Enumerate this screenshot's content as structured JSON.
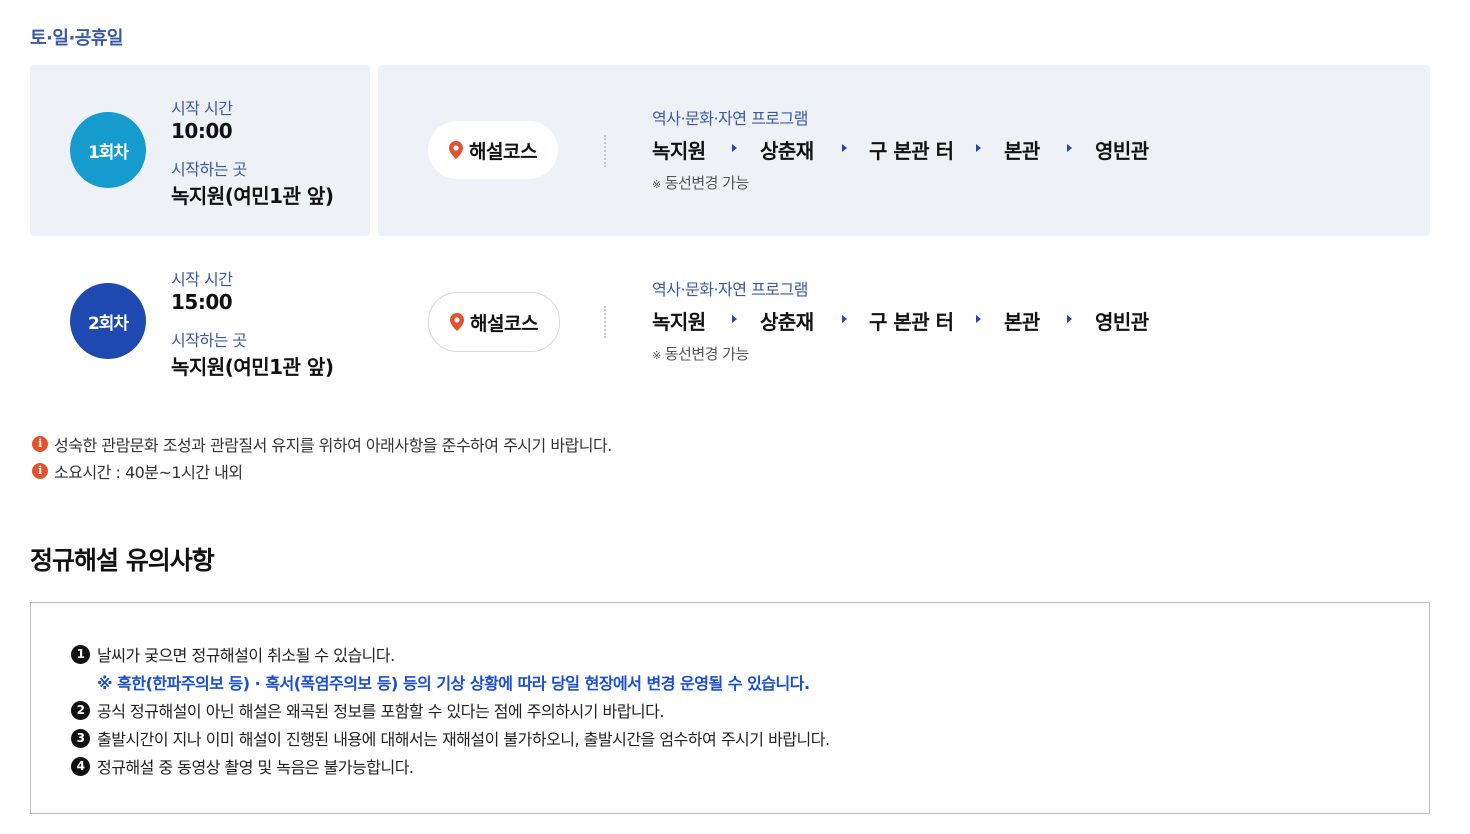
{
  "day_title": "토·일·공휴일",
  "sessions": [
    {
      "badge": "1회차",
      "start_time_label": "시작 시간",
      "start_time": "10:00",
      "start_place_label": "시작하는 곳",
      "start_place": "녹지원(여민1관 앞)",
      "course_label": "해설코스",
      "program": "역사·문화·자연 프로그램",
      "stops": [
        "녹지원",
        "상춘재",
        "구 본관 터",
        "본관",
        "영빈관"
      ],
      "note_mark": "※",
      "note": "동선변경 가능"
    },
    {
      "badge": "2회차",
      "start_time_label": "시작 시간",
      "start_time": "15:00",
      "start_place_label": "시작하는 곳",
      "start_place": "녹지원(여민1관 앞)",
      "course_label": "해설코스",
      "program": "역사·문화·자연 프로그램",
      "stops": [
        "녹지원",
        "상춘재",
        "구 본관 터",
        "본관",
        "영빈관"
      ],
      "note_mark": "※",
      "note": "동선변경 가능"
    }
  ],
  "notices": [
    {
      "icon": "info-icon",
      "glyph": "i",
      "text": "성숙한 관람문화 조성과 관람질서 유지를 위하여 아래사항을 준수하여 주시기 바랍니다."
    },
    {
      "icon": "info-icon",
      "glyph": "i",
      "text": "소요시간 : 40분~1시간 내외"
    }
  ],
  "cautions": {
    "title": "정규해설 유의사항",
    "items": [
      {
        "num": "1",
        "text": "날씨가 궂으면 정규해설이 취소될 수 있습니다."
      },
      {
        "num": "2",
        "text": "공식 정규해설이 아닌 해설은 왜곡된 정보를 포함할 수 있다는 점에 주의하시기 바랍니다."
      },
      {
        "num": "3",
        "text": "출발시간이 지나 이미 해설이 진행된 내용에 대해서는 재해설이 불가하오니, 출발시간을 엄수하여 주시기 바랍니다."
      },
      {
        "num": "4",
        "text": "정규해설 중 동영상 촬영 및 녹음은 불가능합니다."
      }
    ],
    "sub_note": "※ 혹한(한파주의보 등) · 혹서(폭염주의보 등) 등의 기상 상황에 따라 당일 현장에서 변경 운영될 수 있습니다."
  },
  "colors": {
    "label_blue": "#3a5aa8",
    "badge_1": "#169bce",
    "badge_2": "#1d49b0",
    "panel_bg": "#eef1f6",
    "pin_red": "#e2522e",
    "highlight_blue": "#1a4fd0"
  }
}
